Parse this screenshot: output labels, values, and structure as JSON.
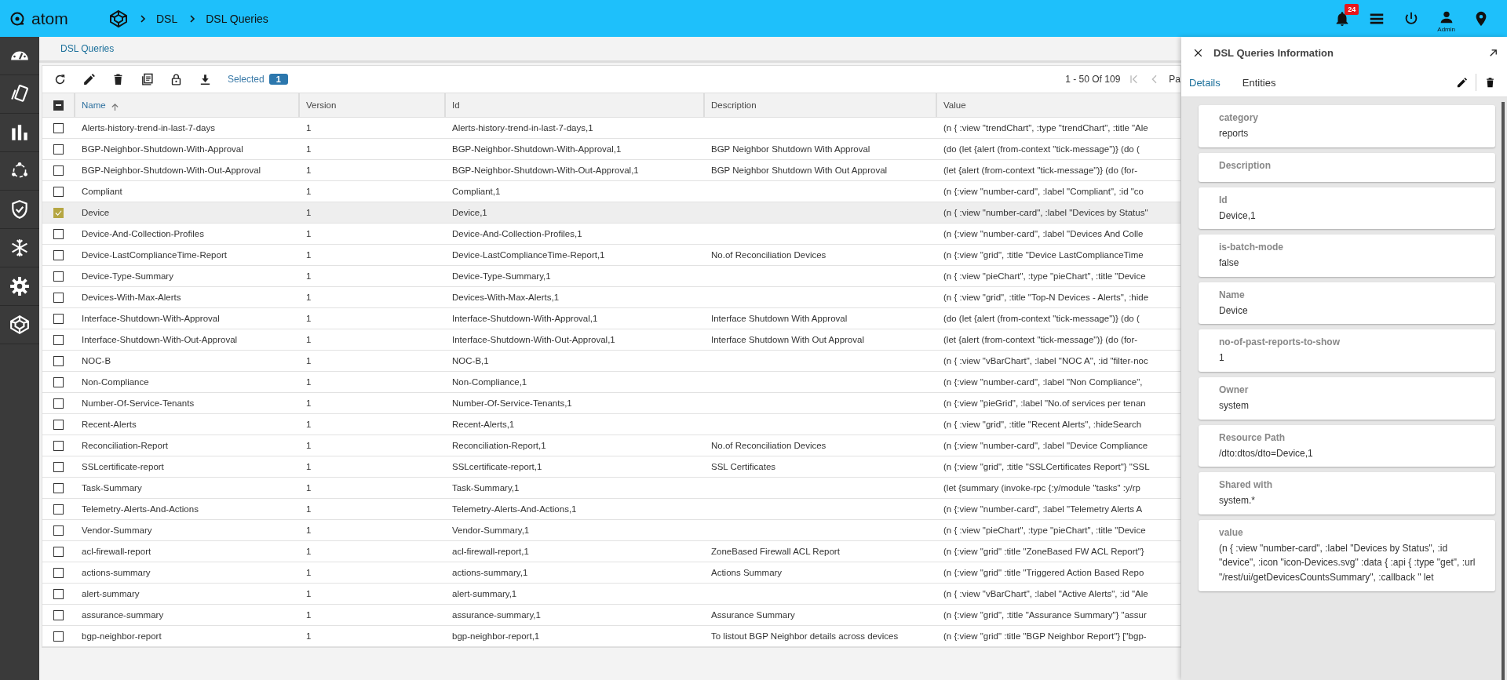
{
  "top_bar": {
    "app_name": "atom",
    "breadcrumb": [
      "DSL",
      "DSL Queries"
    ],
    "notifications": "24",
    "user": "Admin"
  },
  "page_tab": "DSL Queries",
  "toolbar": {
    "selected_label": "Selected",
    "selected_count": "1",
    "pagination": "1 - 50 Of 109",
    "page_label": "Pa"
  },
  "table": {
    "select_all_partial": true,
    "columns": [
      {
        "label": "Name",
        "sorted": true
      },
      {
        "label": "Version",
        "sorted": false
      },
      {
        "label": "Id",
        "sorted": false
      },
      {
        "label": "Description",
        "sorted": false
      },
      {
        "label": "Value",
        "sorted": false
      }
    ],
    "rows": [
      {
        "name": "Alerts-history-trend-in-last-7-days",
        "version": "1",
        "id": "Alerts-history-trend-in-last-7-days,1",
        "value": "(n { :view \"trendChart\", :type \"trendChart\", :title \"Ale",
        "selected": false
      },
      {
        "name": "BGP-Neighbor-Shutdown-With-Approval",
        "version": "1",
        "id": "BGP-Neighbor-Shutdown-With-Approval,1",
        "description": "BGP Neighbor Shutdown With Approval",
        "value": "(do (let {alert (from-context \"tick-message\")} (do (",
        "selected": false
      },
      {
        "name": "BGP-Neighbor-Shutdown-With-Out-Approval",
        "version": "1",
        "id": "BGP-Neighbor-Shutdown-With-Out-Approval,1",
        "description": "BGP Neighbor Shutdown With Out Approval",
        "value": "(let {alert (from-context \"tick-message\")} (do (for-",
        "selected": false
      },
      {
        "name": "Compliant",
        "version": "1",
        "id": "Compliant,1",
        "value": "(n {:view \"number-card\", :label \"Compliant\", :id \"co",
        "selected": false
      },
      {
        "name": "Device",
        "version": "1",
        "id": "Device,1",
        "value": "(n { :view \"number-card\", :label \"Devices by Status\"",
        "selected": true
      },
      {
        "name": "Device-And-Collection-Profiles",
        "version": "1",
        "id": "Device-And-Collection-Profiles,1",
        "value": "(n {:view \"number-card\", :label \"Devices And Colle",
        "selected": false
      },
      {
        "name": "Device-LastComplianceTime-Report",
        "version": "1",
        "id": "Device-LastComplianceTime-Report,1",
        "description": "No.of Reconciliation Devices",
        "value": "(n {:view \"grid\", :title \"Device LastComplianceTime",
        "selected": false
      },
      {
        "name": "Device-Type-Summary",
        "version": "1",
        "id": "Device-Type-Summary,1",
        "value": "(n { :view \"pieChart\", :type \"pieChart\", :title \"Device",
        "selected": false
      },
      {
        "name": "Devices-With-Max-Alerts",
        "version": "1",
        "id": "Devices-With-Max-Alerts,1",
        "value": "(n { :view \"grid\", :title \"Top-N Devices - Alerts\", :hide",
        "selected": false
      },
      {
        "name": "Interface-Shutdown-With-Approval",
        "version": "1",
        "id": "Interface-Shutdown-With-Approval,1",
        "description": "Interface Shutdown With Approval",
        "value": "(do (let {alert (from-context \"tick-message\")} (do (",
        "selected": false
      },
      {
        "name": "Interface-Shutdown-With-Out-Approval",
        "version": "1",
        "id": "Interface-Shutdown-With-Out-Approval,1",
        "description": "Interface Shutdown With Out Approval",
        "value": "(let {alert (from-context \"tick-message\")} (do (for-",
        "selected": false
      },
      {
        "name": "NOC-B",
        "version": "1",
        "id": "NOC-B,1",
        "value": "(n { :view \"vBarChart\", :label \"NOC A\", :id \"filter-noc",
        "selected": false
      },
      {
        "name": "Non-Compliance",
        "version": "1",
        "id": "Non-Compliance,1",
        "value": "(n {:view \"number-card\", :label \"Non Compliance\",",
        "selected": false
      },
      {
        "name": "Number-Of-Service-Tenants",
        "version": "1",
        "id": "Number-Of-Service-Tenants,1",
        "value": "(n {:view \"pieGrid\", :label \"No.of services per tenan",
        "selected": false
      },
      {
        "name": "Recent-Alerts",
        "version": "1",
        "id": "Recent-Alerts,1",
        "value": "(n { :view \"grid\", :title \"Recent Alerts\", :hideSearch",
        "selected": false
      },
      {
        "name": "Reconciliation-Report",
        "version": "1",
        "id": "Reconciliation-Report,1",
        "description": "No.of Reconciliation Devices",
        "value": "(n {:view \"number-card\", :label \"Device Compliance",
        "selected": false
      },
      {
        "name": "SSLcertificate-report",
        "version": "1",
        "id": "SSLcertificate-report,1",
        "description": "SSL Certificates",
        "value": "(n {:view \"grid\", :title \"SSLCertificates Report\"} \"SSL",
        "selected": false
      },
      {
        "name": "Task-Summary",
        "version": "1",
        "id": "Task-Summary,1",
        "value": "(let {summary (invoke-rpc {:y/module \"tasks\" :y/rp",
        "selected": false
      },
      {
        "name": "Telemetry-Alerts-And-Actions",
        "version": "1",
        "id": "Telemetry-Alerts-And-Actions,1",
        "value": "(n {:view \"number-card\", :label \"Telemetry Alerts A",
        "selected": false
      },
      {
        "name": "Vendor-Summary",
        "version": "1",
        "id": "Vendor-Summary,1",
        "value": "(n { :view \"pieChart\", :type \"pieChart\", :title \"Device",
        "selected": false
      },
      {
        "name": "acl-firewall-report",
        "version": "1",
        "id": "acl-firewall-report,1",
        "description": "ZoneBased Firewall ACL Report",
        "value": "(n {:view \"grid\" :title \"ZoneBased FW ACL Report\"}",
        "selected": false
      },
      {
        "name": "actions-summary",
        "version": "1",
        "id": "actions-summary,1",
        "description": "Actions Summary",
        "value": "(n {:view \"grid\" :title \"Triggered Action Based Repo",
        "selected": false
      },
      {
        "name": "alert-summary",
        "version": "1",
        "id": "alert-summary,1",
        "value": "(n { :view \"vBarChart\", :label \"Active Alerts\", :id \"Ale",
        "selected": false
      },
      {
        "name": "assurance-summary",
        "version": "1",
        "id": "assurance-summary,1",
        "description": "Assurance Summary",
        "value": "(n {:view \"grid\", :title \"Assurance Summary\"} \"assur",
        "selected": false
      },
      {
        "name": "bgp-neighbor-report",
        "version": "1",
        "id": "bgp-neighbor-report,1",
        "description": "To listout BGP Neighbor details across devices",
        "value": "(n {:view \"grid\" :title \"BGP Neighbor Report\"} [\"bgp-",
        "selected": false
      }
    ]
  },
  "panel": {
    "title": "DSL Queries Information",
    "tabs": [
      {
        "label": "Details",
        "selected": true
      },
      {
        "label": "Entities",
        "selected": false
      }
    ],
    "fields": [
      {
        "label": "category",
        "value": "reports"
      },
      {
        "label": "Description"
      },
      {
        "label": "Id",
        "value": "Device,1"
      },
      {
        "label": "is-batch-mode",
        "value": "false"
      },
      {
        "label": "Name",
        "value": "Device"
      },
      {
        "label": "no-of-past-reports-to-show",
        "value": "1"
      },
      {
        "label": "Owner",
        "value": "system"
      },
      {
        "label": "Resource Path",
        "value": "/dto:dtos/dto=Device,1"
      },
      {
        "label": "Shared with",
        "value": "system.*"
      },
      {
        "label": "value",
        "value": "(n { :view \"number-card\", :label \"Devices by Status\", :id \"device\", :icon \"icon-Devices.svg\" :data { :api { :type \"get\", :url \"/rest/ui/getDevicesCountsSummary\", :callback \" let"
      }
    ]
  }
}
